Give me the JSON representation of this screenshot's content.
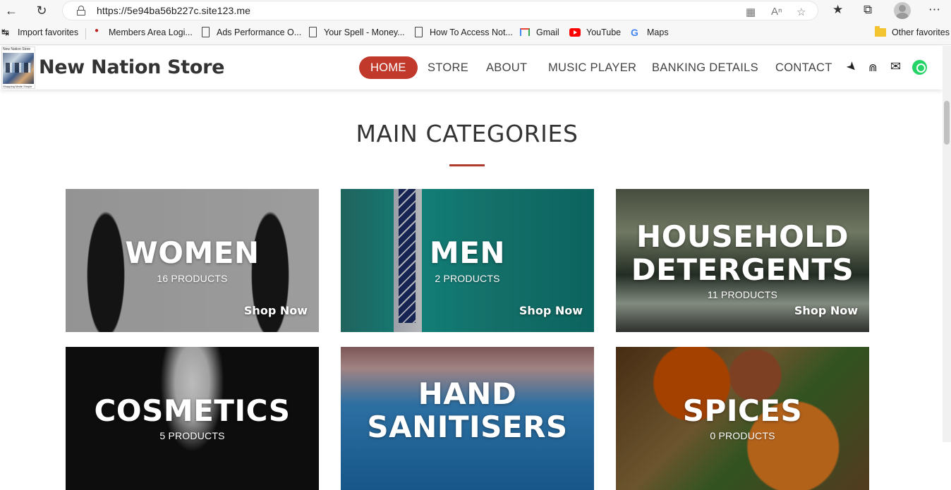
{
  "browser": {
    "url": "https://5e94ba56b227c.site123.me",
    "favorites": [
      {
        "label": "Import favorites"
      },
      {
        "label": "Members Area Logi..."
      },
      {
        "label": "Ads Performance O..."
      },
      {
        "label": "Your Spell - Money..."
      },
      {
        "label": "How To Access Not..."
      },
      {
        "label": "Gmail"
      },
      {
        "label": "YouTube"
      },
      {
        "label": "Maps"
      },
      {
        "label": "Other favorites"
      }
    ]
  },
  "site": {
    "logo_top_text": "New Nation Store",
    "logo_bottom_text": "Shopping Made Simple",
    "title": "New Nation Store",
    "menu": [
      {
        "label": "HOME",
        "active": true
      },
      {
        "label": "STORE"
      },
      {
        "label": "ABOUT"
      },
      {
        "label": "MUSIC PLAYER"
      },
      {
        "label": "BANKING DETAILS"
      },
      {
        "label": "CONTACT"
      }
    ],
    "accent_color": "#c0392b"
  },
  "main": {
    "section_title": "MAIN CATEGORIES",
    "categories": [
      {
        "name": "WOMEN",
        "count": "16 PRODUCTS",
        "cta": "Shop Now"
      },
      {
        "name": "MEN",
        "count": "2 PRODUCTS",
        "cta": "Shop Now"
      },
      {
        "name_line1": "HOUSEHOLD",
        "name_line2": "DETERGENTS",
        "count": "11 PRODUCTS",
        "cta": "Shop Now"
      },
      {
        "name": "COSMETICS",
        "count": "5 PRODUCTS"
      },
      {
        "name_line1": "HAND",
        "name_line2": "SANITISERS"
      },
      {
        "name": "SPICES",
        "count": "0 PRODUCTS"
      }
    ]
  }
}
